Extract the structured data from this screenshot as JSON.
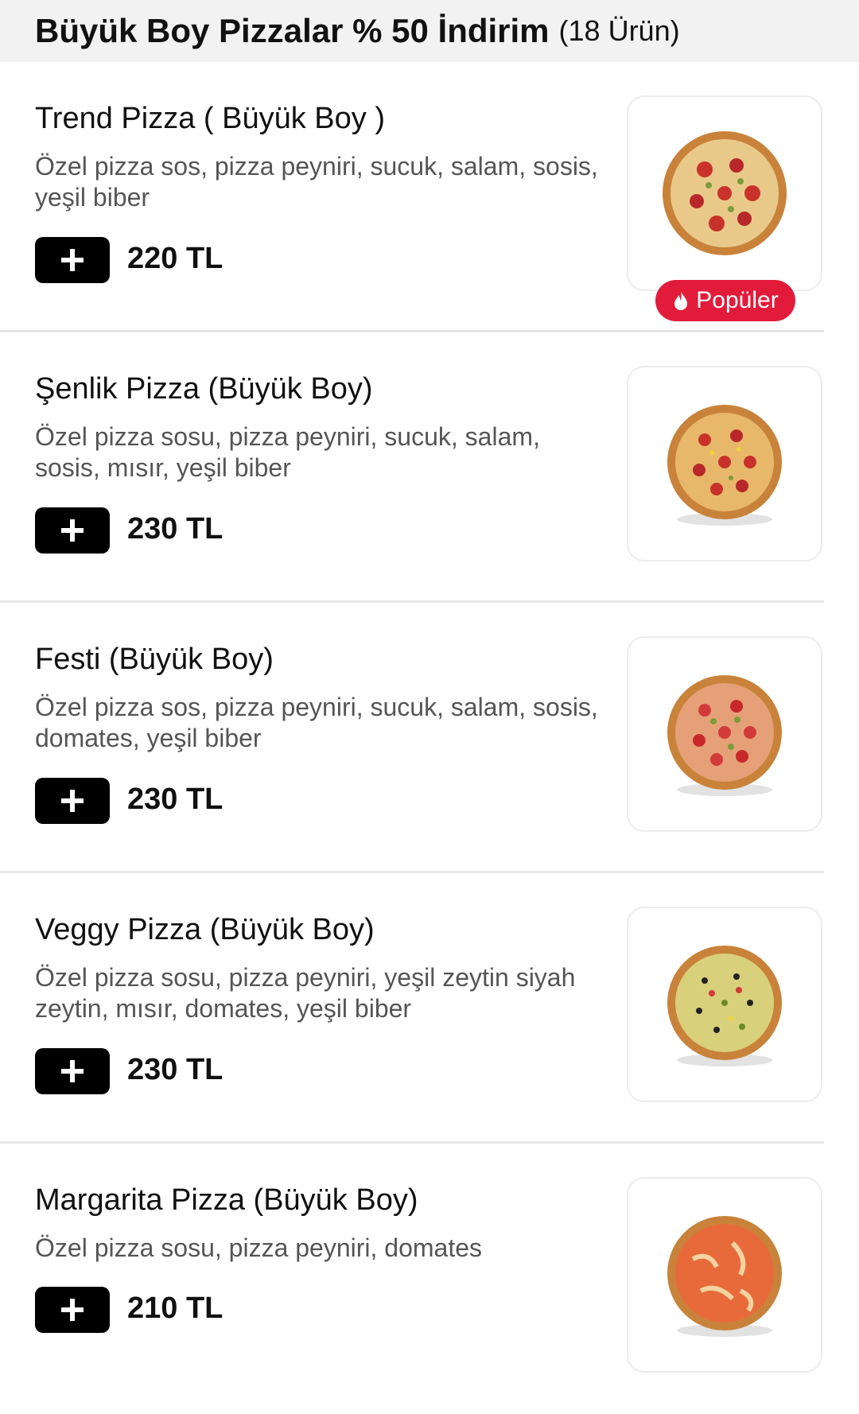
{
  "category": {
    "title": "Büyük Boy Pizzalar % 50 İndirim",
    "count": "(18 Ürün)"
  },
  "products": [
    {
      "name": "Trend Pizza ( Büyük Boy )",
      "description": "Özel pizza sos, pizza peyniri, sucuk, salam, sosis, yeşil biber",
      "price": "220 TL",
      "badge": "Popüler"
    },
    {
      "name": "Şenlik Pizza (Büyük Boy)",
      "description": "Özel pizza sosu, pizza peyniri, sucuk, salam, sosis, mısır, yeşil biber",
      "price": "230 TL"
    },
    {
      "name": "Festi (Büyük Boy)",
      "description": "Özel pizza sos, pizza peyniri, sucuk, salam, sosis, domates, yeşil biber",
      "price": "230 TL"
    },
    {
      "name": "Veggy Pizza (Büyük Boy)",
      "description": "Özel pizza sosu, pizza peyniri, yeşil zeytin siyah zeytin, mısır, domates, yeşil biber",
      "price": "230 TL"
    },
    {
      "name": "Margarita Pizza (Büyük Boy)",
      "description": "Özel pizza sosu, pizza peyniri, domates",
      "price": "210 TL"
    }
  ],
  "icons": {
    "add": "plus-icon",
    "badge": "flame-icon"
  },
  "colors": {
    "badge_bg": "#e31b3b",
    "button_bg": "#000000",
    "header_bg": "#f2f2f2"
  }
}
